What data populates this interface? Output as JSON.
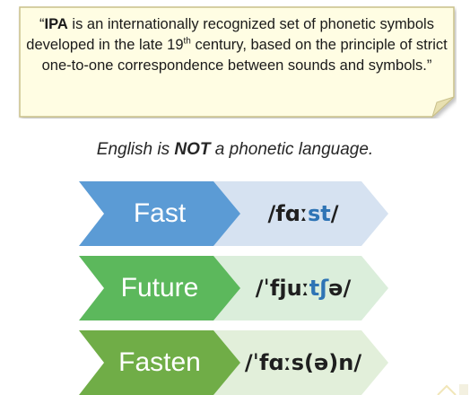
{
  "quote": {
    "open": "“",
    "term": "IPA",
    "text_before_sup": " is an internationally recognized set of phonetic symbols developed in the late 19",
    "sup": "th",
    "text_after_sup": " century, based on the principle of strict one-to-one correspondence between sounds and symbols.",
    "close": "”"
  },
  "subtitle": {
    "before": "English is ",
    "emphasis": "NOT",
    "after": " a phonetic language."
  },
  "rows": [
    {
      "word": "Fast",
      "ipa": {
        "before": "/fɑː",
        "highlight": "st",
        "after": "/"
      },
      "colors": {
        "chevron": "#5b9bd5",
        "pentagon": "#d6e2f1"
      }
    },
    {
      "word": "Future",
      "ipa": {
        "before": "/ˈfjuː",
        "highlight": "tʃ",
        "after": "ə/"
      },
      "colors": {
        "chevron": "#5cb85c",
        "pentagon": "#dbeedb"
      }
    },
    {
      "word": "Fasten",
      "ipa": {
        "before": "/ˈfɑːs(ə)n/",
        "highlight": "",
        "after": ""
      },
      "colors": {
        "chevron": "#70ad47",
        "pentagon": "#e2efda"
      }
    }
  ],
  "colors": {
    "note_fill": "#fffde3",
    "note_border": "#c9c08a",
    "highlight": "#2e74b5"
  },
  "icons": [
    "corner-logo-icon"
  ]
}
